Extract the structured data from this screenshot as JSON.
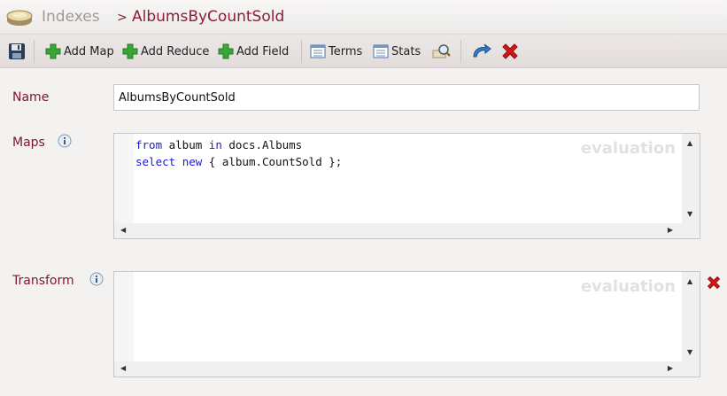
{
  "header": {
    "breadcrumb_root": "Indexes",
    "breadcrumb_sep": ">",
    "breadcrumb_current": "AlbumsByCountSold"
  },
  "toolbar": {
    "add_map": "Add Map",
    "add_reduce": "Add Reduce",
    "add_field": "Add Field",
    "terms": "Terms",
    "stats": "Stats"
  },
  "form": {
    "name_label": "Name",
    "name_value": "AlbumsByCountSold",
    "maps_label": "Maps",
    "maps_code_line1_kw1": "from",
    "maps_code_line1_a": " album ",
    "maps_code_line1_kw2": "in",
    "maps_code_line1_b": " docs.Albums",
    "maps_code_line2_kw1": "select",
    "maps_code_line2_a": " ",
    "maps_code_line2_kw2": "new",
    "maps_code_line2_b": " { album.CountSold };",
    "transform_label": "Transform",
    "watermark": "evaluation"
  },
  "colors": {
    "accent": "#8a1d3a",
    "keyword": "#1a1adc",
    "add_green": "#3aa63a",
    "delete_red": "#d01818"
  }
}
